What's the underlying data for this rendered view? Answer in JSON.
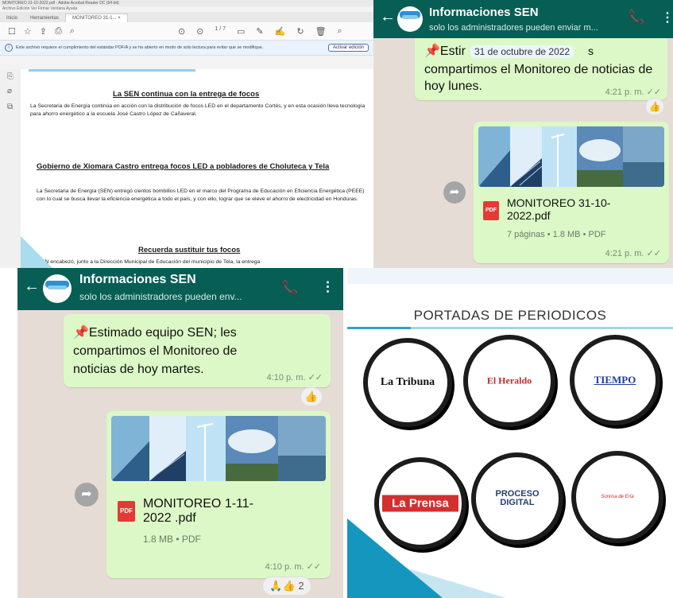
{
  "pdf_viewer": {
    "window_title": "MONITOREO 31-10-2022.pdf - Adobe Acrobat Reader DC (64-bit)",
    "menu": "Archivo  Edición  Ver  Firmar  Ventana  Ayuda",
    "tabs": [
      "Inicio",
      "Herramientas",
      "MONITOREO 31-1... ×"
    ],
    "toolbar_page": "1 / 7",
    "notice_text": "Este archivo requiere el cumplimiento del estándar PDF/A y se ha abierto en modo de solo lectura para evitar que se modifique.",
    "notice_button": "Activar edición",
    "articles": [
      {
        "title": "La SEN continua con la entrega de focos",
        "body": "La Secretaria de Energía continúa en acción con la distribución de focos LED en el departamento Cortés, y en esta ocasión lleva tecnología para ahorro energético a la escuela José Castro López de Cañaveral."
      },
      {
        "title": "Gobierno de Xiomara Castro entrega focos LED a pobladores de Choluteca y Tela",
        "body": "La Secretaria de Energía (SEN) entregó cientos bombillos LED en el marco del Programa de Educación en Eficiencia Energética (PEEE) con lo cual se busca llevar la eficiencia energética a todo el país, y con ello, lograr que se eleve el ahorro de electricidad en Honduras."
      },
      {
        "title": "Recuerda sustituir tus focos",
        "body": "La SEN encabezó, junto a la Dirección Municipal de Educación del municipio de Tela, la entrega"
      }
    ]
  },
  "chat_top": {
    "name": "Informaciones SEN",
    "subtitle": "solo los administradores pueden enviar m...",
    "message_prefix": "📌Estir",
    "date_overlay": "31 de octubre de 2022",
    "message_suffix": "s",
    "message_rest": "compartimos el Monitoreo de noticias de hoy lunes.",
    "message_time": "4:21 p. m. ✓✓",
    "reaction": "👍",
    "doc_name": "MONITOREO 31-10-2022.pdf",
    "doc_meta": "7 páginas • 1.8 MB • PDF",
    "doc_time": "4:21 p. m. ✓✓",
    "pdf_badge": "PDF"
  },
  "chat_bottom": {
    "name": "Informaciones SEN",
    "subtitle": "solo los administradores pueden env...",
    "message": "📌Estimado equipo SEN; les compartimos el Monitoreo de noticias de hoy martes.",
    "message_time": "4:10 p. m. ✓✓",
    "reaction": "👍",
    "doc_name": "MONITOREO 1-11-2022 .pdf",
    "doc_meta": "1.8 MB • PDF",
    "doc_time": "4:10 p. m. ✓✓",
    "reactions_row": "🙏👍 2",
    "pdf_badge": "PDF"
  },
  "newspapers": {
    "title": "PORTADAS DE PERIODICOS",
    "items": [
      "La Tribuna",
      "El Heraldo",
      "TIEMPO",
      "La Prensa",
      "PROCESO DIGITAL",
      "Sonrisa de Ería"
    ]
  },
  "colors": {
    "wa_header": "#075e54",
    "wa_bubble": "#dcf8c6",
    "wa_background": "#e5ddd5",
    "accent_blue": "#2aa3c9",
    "pdf_red": "#e53935"
  }
}
